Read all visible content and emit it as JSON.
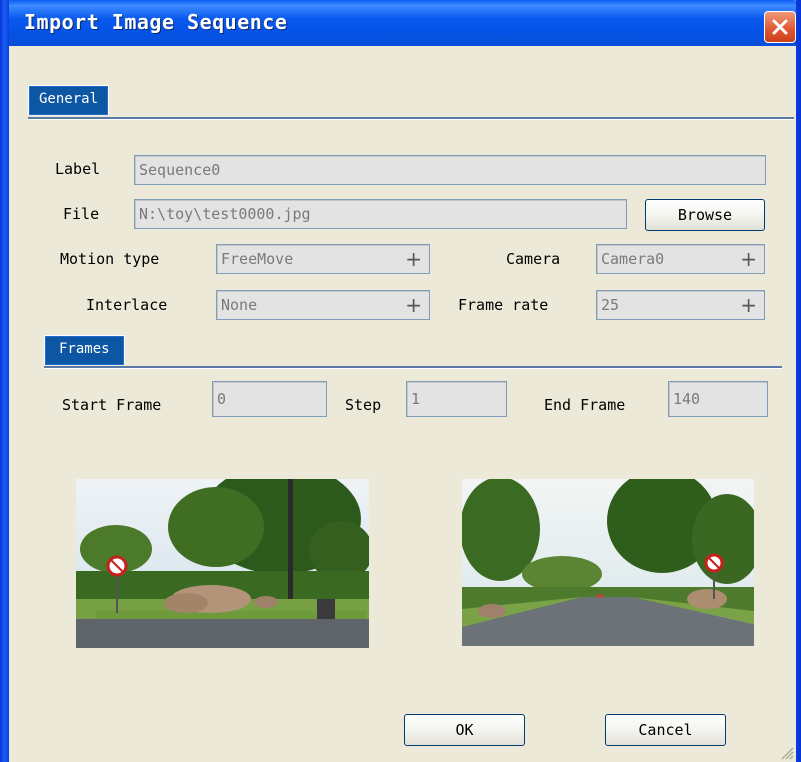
{
  "window": {
    "title": "Import Image Sequence"
  },
  "tabs": {
    "general": "General",
    "frames": "Frames"
  },
  "general": {
    "label_caption": "Label",
    "label_value": "Sequence0",
    "file_caption": "File",
    "file_value": "N:\\toy\\test0000.jpg",
    "browse": "Browse",
    "motion_caption": "Motion type",
    "motion_value": "FreeMove",
    "camera_caption": "Camera",
    "camera_value": "Camera0",
    "interlace_caption": "Interlace",
    "interlace_value": "None",
    "framerate_caption": "Frame rate",
    "framerate_value": "25"
  },
  "frames": {
    "start_caption": "Start Frame",
    "start_value": "0",
    "step_caption": "Step",
    "step_value": "1",
    "end_caption": "End Frame",
    "end_value": "140"
  },
  "buttons": {
    "ok": "OK",
    "cancel": "Cancel"
  },
  "icons": {
    "close": "close-icon",
    "plus": "plus-icon",
    "grip": "resize-grip-icon"
  }
}
